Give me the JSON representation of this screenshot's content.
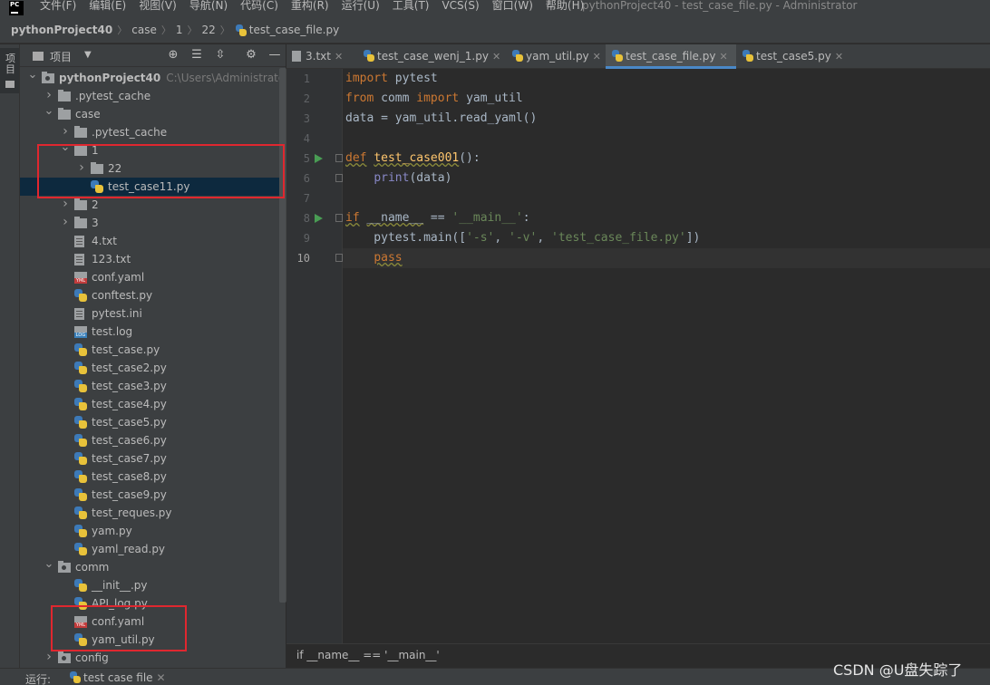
{
  "menubar": {
    "items": [
      "文件(F)",
      "编辑(E)",
      "视图(V)",
      "导航(N)",
      "代码(C)",
      "重构(R)",
      "运行(U)",
      "工具(T)",
      "VCS(S)",
      "窗口(W)",
      "帮助(H)"
    ],
    "window_title": "pythonProject40 - test_case_file.py - Administrator"
  },
  "breadcrumb": {
    "project": "pythonProject40",
    "parts": [
      "case",
      "1",
      "22"
    ],
    "file": "test_case_file.py"
  },
  "tool_strip": {
    "project_tab": "项目"
  },
  "project_panel": {
    "title": "项目",
    "tree": [
      {
        "label": "pythonProject40",
        "hint": "C:\\Users\\Administrator\\P",
        "icon": "module-folder",
        "level": 0,
        "expanded": true
      },
      {
        "label": ".pytest_cache",
        "icon": "folder",
        "level": 1,
        "expanded": false
      },
      {
        "label": "case",
        "icon": "folder",
        "level": 1,
        "expanded": true
      },
      {
        "label": ".pytest_cache",
        "icon": "folder",
        "level": 2,
        "expanded": false
      },
      {
        "label": "1",
        "icon": "folder",
        "level": 2,
        "expanded": true
      },
      {
        "label": "22",
        "icon": "folder",
        "level": 3,
        "expanded": false
      },
      {
        "label": "test_case11.py",
        "icon": "python-file",
        "level": 3,
        "selected": true
      },
      {
        "label": "2",
        "icon": "folder",
        "level": 2,
        "expanded": false
      },
      {
        "label": "3",
        "icon": "folder",
        "level": 2,
        "expanded": false
      },
      {
        "label": "4.txt",
        "icon": "text-file",
        "level": 2
      },
      {
        "label": "123.txt",
        "icon": "text-file",
        "level": 2
      },
      {
        "label": "conf.yaml",
        "icon": "yaml-file",
        "level": 2
      },
      {
        "label": "conftest.py",
        "icon": "python-file",
        "level": 2
      },
      {
        "label": "pytest.ini",
        "icon": "text-file",
        "level": 2
      },
      {
        "label": "test.log",
        "icon": "log-file",
        "level": 2
      },
      {
        "label": "test_case.py",
        "icon": "python-file",
        "level": 2
      },
      {
        "label": "test_case2.py",
        "icon": "python-file",
        "level": 2
      },
      {
        "label": "test_case3.py",
        "icon": "python-file",
        "level": 2
      },
      {
        "label": "test_case4.py",
        "icon": "python-file",
        "level": 2
      },
      {
        "label": "test_case5.py",
        "icon": "python-file",
        "level": 2
      },
      {
        "label": "test_case6.py",
        "icon": "python-file",
        "level": 2
      },
      {
        "label": "test_case7.py",
        "icon": "python-file",
        "level": 2
      },
      {
        "label": "test_case8.py",
        "icon": "python-file",
        "level": 2
      },
      {
        "label": "test_case9.py",
        "icon": "python-file",
        "level": 2
      },
      {
        "label": "test_reques.py",
        "icon": "python-file",
        "level": 2
      },
      {
        "label": "yam.py",
        "icon": "python-file",
        "level": 2
      },
      {
        "label": "yaml_read.py",
        "icon": "python-file",
        "level": 2
      },
      {
        "label": "comm",
        "icon": "module-folder",
        "level": 1,
        "expanded": true
      },
      {
        "label": "__init__.py",
        "icon": "python-file",
        "level": 2
      },
      {
        "label": "API_log.py",
        "icon": "python-file",
        "level": 2
      },
      {
        "label": "conf.yaml",
        "icon": "yaml-file",
        "level": 2
      },
      {
        "label": "yam_util.py",
        "icon": "python-file",
        "level": 2
      },
      {
        "label": "config",
        "icon": "module-folder",
        "level": 1,
        "expanded": false
      }
    ]
  },
  "editor": {
    "tabs": [
      {
        "label": "3.txt",
        "icon": "text-file",
        "active": false
      },
      {
        "label": "test_case_wenj_1.py",
        "icon": "python-file",
        "active": false
      },
      {
        "label": "yam_util.py",
        "icon": "python-file",
        "active": false
      },
      {
        "label": "test_case_file.py",
        "icon": "python-file",
        "active": true
      },
      {
        "label": "test_case5.py",
        "icon": "python-file",
        "active": false
      }
    ],
    "line_numbers": [
      "1",
      "2",
      "3",
      "4",
      "5",
      "6",
      "7",
      "8",
      "9",
      "10"
    ],
    "current_line": 10,
    "run_markers_on_lines": [
      5,
      8
    ],
    "code": {
      "l1_kw": "import",
      "l1_rest": " pytest",
      "l2_kw": "from",
      "l2_mod": " comm ",
      "l2_kw2": "import",
      "l2_rest": " yam_util",
      "l3": "data = yam_util.read_yaml()",
      "l5_kw": "def",
      "l5_sp": " ",
      "l5_fn": "test_case001",
      "l5_rest": "():",
      "l6_indent": "    ",
      "l6_bi": "print",
      "l6_rest": "(data)",
      "l8_kw": "if",
      "l8_sp": " ",
      "l8_dunder": "__name__",
      "l8_eq": " == ",
      "l8_str": "'__main__'",
      "l8_colon": ":",
      "l9_pre": "    pytest.main([",
      "l9_s1": "'-s'",
      "l9_c1": ", ",
      "l9_s2": "'-v'",
      "l9_c2": ", ",
      "l9_s3": "'test_case_file.py'",
      "l9_post": "])",
      "l10_indent": "    ",
      "l10_kw": "pass"
    },
    "breadcrumb_text": "if __name__ == '__main__'"
  },
  "runbar": {
    "label": "运行:",
    "tab": "test case file"
  },
  "watermark": "CSDN @U盘失踪了",
  "colors": {
    "keyword": "#cc7832",
    "function": "#ffc66d",
    "string": "#6a8759",
    "builtin": "#8888c6",
    "annotation_box": "#e0272f",
    "selection": "#0d293e"
  }
}
